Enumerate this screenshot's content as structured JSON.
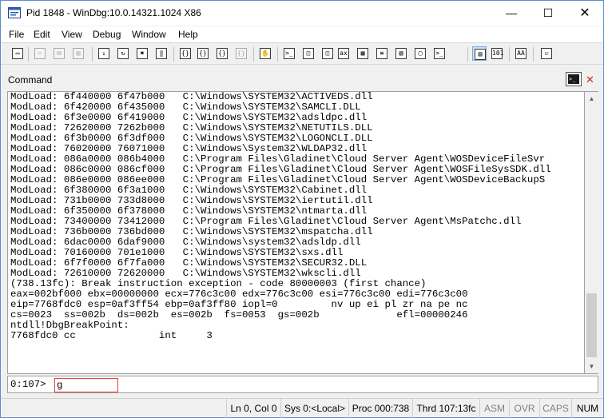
{
  "window": {
    "title": "Pid 1848 - WinDbg:10.0.14321.1024 X86",
    "minimize_glyph": "—",
    "maximize_glyph": "☐",
    "close_glyph": "✕"
  },
  "menu": {
    "items": [
      "File",
      "Edit",
      "View",
      "Debug",
      "Window",
      "Help"
    ]
  },
  "toolbar": {
    "buttons": [
      {
        "icon": "open-folder-icon",
        "glyph": "▭",
        "enabled": true
      },
      {
        "icon": "cut-icon",
        "glyph": "✂",
        "enabled": false
      },
      {
        "icon": "copy-icon",
        "glyph": "⧉",
        "enabled": false
      },
      {
        "icon": "paste-icon",
        "glyph": "▤",
        "enabled": false
      },
      {
        "icon": "go-icon",
        "glyph": "↓",
        "enabled": true
      },
      {
        "icon": "restart-icon",
        "glyph": "↻",
        "enabled": true
      },
      {
        "icon": "stop-debugging-icon",
        "glyph": "✖",
        "enabled": true
      },
      {
        "icon": "break-icon",
        "glyph": "‖",
        "enabled": true
      },
      {
        "icon": "step-into-icon",
        "glyph": "{}",
        "enabled": true
      },
      {
        "icon": "step-over-icon",
        "glyph": "{}",
        "enabled": true
      },
      {
        "icon": "step-out-icon",
        "glyph": "{}",
        "enabled": true
      },
      {
        "icon": "run-to-cursor-icon",
        "glyph": "{}",
        "enabled": false
      },
      {
        "icon": "hand-icon",
        "glyph": "✋",
        "enabled": true
      },
      {
        "icon": "command-window-icon",
        "glyph": ">_",
        "enabled": true
      },
      {
        "icon": "watch-window-icon",
        "glyph": "◫",
        "enabled": true
      },
      {
        "icon": "locals-window-icon",
        "glyph": "◫",
        "enabled": true
      },
      {
        "icon": "registers-window-icon",
        "glyph": "ax",
        "enabled": true
      },
      {
        "icon": "memory-window-icon",
        "glyph": "▦",
        "enabled": true
      },
      {
        "icon": "call-stack-window-icon",
        "glyph": "≡",
        "enabled": true
      },
      {
        "icon": "disassembly-window-icon",
        "glyph": "▧",
        "enabled": true
      },
      {
        "icon": "scratch-pad-icon",
        "glyph": "▢",
        "enabled": true
      },
      {
        "icon": "processes-threads-icon",
        "glyph": ">_",
        "enabled": true
      },
      {
        "icon": "source-mode-icon",
        "glyph": "▤",
        "enabled": true,
        "pressed": true
      },
      {
        "icon": "hex-mode-icon",
        "glyph": "101",
        "enabled": true
      },
      {
        "icon": "font-icon",
        "glyph": "AA",
        "enabled": true
      },
      {
        "icon": "options-icon",
        "glyph": "☑",
        "enabled": true
      }
    ]
  },
  "command_window": {
    "title": "Command",
    "close_glyph": "✕",
    "output_lines": [
      "ModLoad: 6f440000 6f47b000   C:\\Windows\\SYSTEM32\\ACTIVEDS.dll",
      "ModLoad: 6f420000 6f435000   C:\\Windows\\SYSTEM32\\SAMCLI.DLL",
      "ModLoad: 6f3e0000 6f419000   C:\\Windows\\SYSTEM32\\adsldpc.dll",
      "ModLoad: 72620000 7262b000   C:\\Windows\\SYSTEM32\\NETUTILS.DLL",
      "ModLoad: 6f3b0000 6f3df000   C:\\Windows\\SYSTEM32\\LOGONCLI.DLL",
      "ModLoad: 76020000 76071000   C:\\Windows\\System32\\WLDAP32.dll",
      "ModLoad: 086a0000 086b4000   C:\\Program Files\\Gladinet\\Cloud Server Agent\\WOSDeviceFileSvr",
      "ModLoad: 086c0000 086cf000   C:\\Program Files\\Gladinet\\Cloud Server Agent\\WOSFileSysSDK.dll",
      "ModLoad: 086e0000 086ee000   C:\\Program Files\\Gladinet\\Cloud Server Agent\\WOSDeviceBackupS",
      "ModLoad: 6f380000 6f3a1000   C:\\Windows\\SYSTEM32\\Cabinet.dll",
      "ModLoad: 731b0000 733d8000   C:\\Windows\\SYSTEM32\\iertutil.dll",
      "ModLoad: 6f350000 6f378000   C:\\Windows\\SYSTEM32\\ntmarta.dll",
      "ModLoad: 73400000 73412000   C:\\Program Files\\Gladinet\\Cloud Server Agent\\MsPatchc.dll",
      "ModLoad: 736b0000 736bd000   C:\\Windows\\SYSTEM32\\mspatcha.dll",
      "ModLoad: 6dac0000 6daf9000   C:\\Windows\\system32\\adsldp.dll",
      "ModLoad: 70160000 701e1000   C:\\Windows\\SYSTEM32\\sxs.dll",
      "ModLoad: 6f7f0000 6f7fa000   C:\\Windows\\SYSTEM32\\SECUR32.DLL",
      "ModLoad: 72610000 72620000   C:\\Windows\\SYSTEM32\\wkscli.dll",
      "(738.13fc): Break instruction exception - code 80000003 (first chance)",
      "eax=002bf000 ebx=00000000 ecx=776c3c00 edx=776c3c00 esi=776c3c00 edi=776c3c00",
      "eip=7768fdc0 esp=0af3ff54 ebp=0af3ff80 iopl=0         nv up ei pl zr na pe nc",
      "cs=0023  ss=002b  ds=002b  es=002b  fs=0053  gs=002b             efl=00000246",
      "ntdll!DbgBreakPoint:",
      "7768fdc0 cc              int     3"
    ],
    "prompt": "0:107>",
    "input_value": "g"
  },
  "status_bar": {
    "line_col": "Ln 0, Col 0",
    "sys": "Sys 0:<Local>",
    "proc": "Proc 000:738",
    "thrd": "Thrd 107:13fc",
    "asm": "ASM",
    "ovr": "OVR",
    "caps": "CAPS",
    "num": "NUM"
  }
}
